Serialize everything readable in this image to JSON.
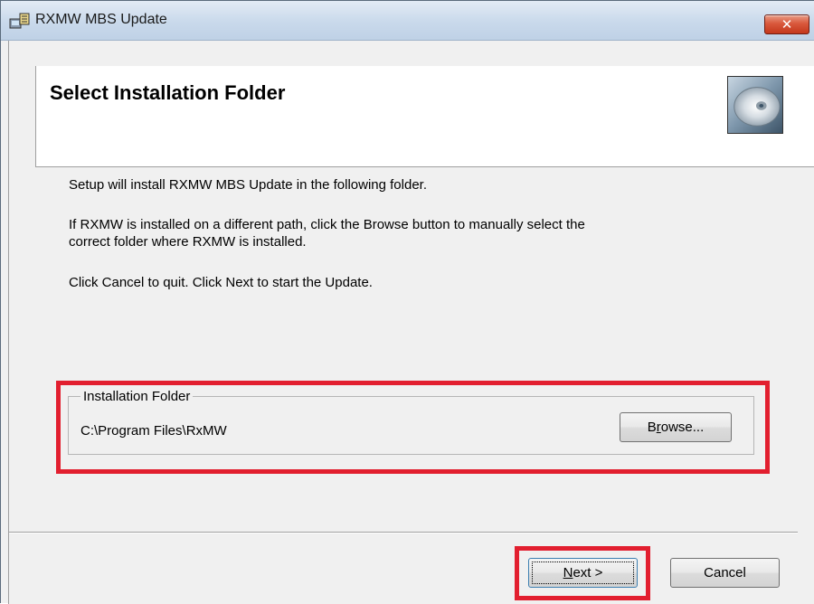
{
  "window": {
    "title": "RXMW MBS Update",
    "close_label": "✕"
  },
  "banner": {
    "title": "Select Installation Folder",
    "icon": "cd-disc-icon"
  },
  "body": {
    "line1": "Setup will install RXMW MBS Update in the following folder.",
    "line2a": "If RXMW is installed on a different path, click the Browse button to manually select the",
    "line2b": "correct folder where RXMW is installed.",
    "line3": "Click Cancel to quit.  Click Next to start the Update."
  },
  "install_folder": {
    "label": "Installation Folder",
    "path": "C:\\Program Files\\RxMW",
    "browse_label_pre": "B",
    "browse_label_ul": "r",
    "browse_label_post": "owse..."
  },
  "footer": {
    "next_label_ul": "N",
    "next_label_post": "ext >",
    "cancel_label": "Cancel"
  },
  "colors": {
    "highlight": "#e21f2f",
    "close_button": "#d9583c"
  }
}
